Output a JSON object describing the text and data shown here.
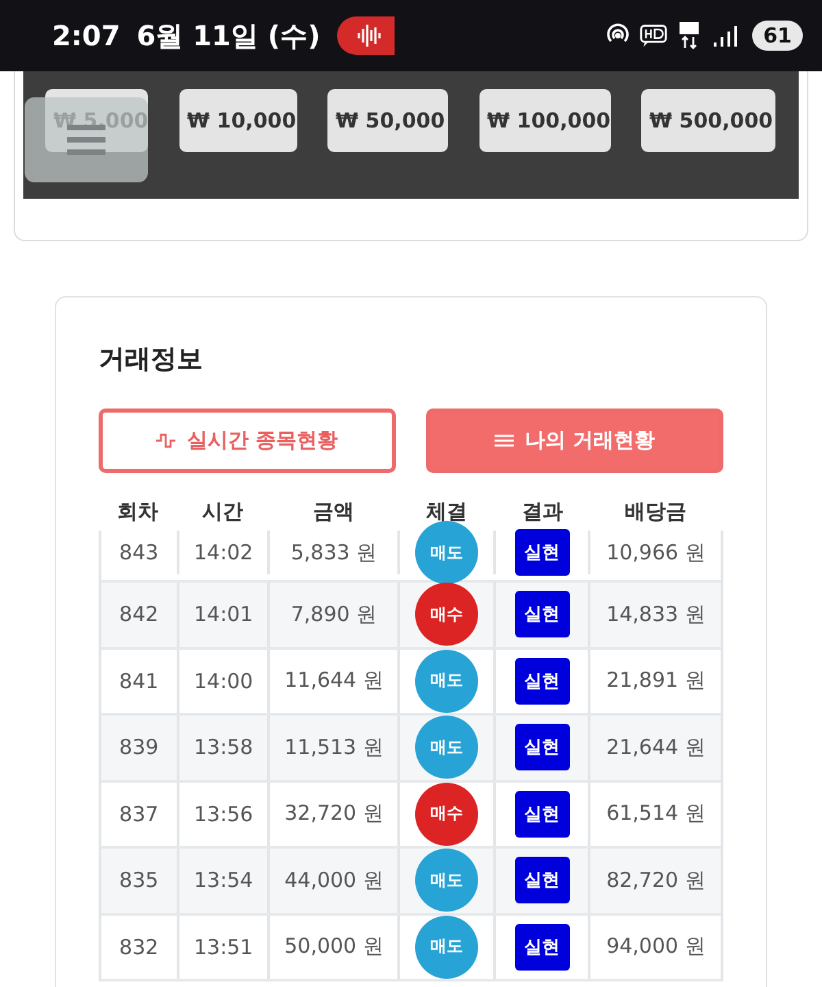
{
  "status_bar": {
    "time": "2:07",
    "date": "6월 11일 (수)",
    "battery": "61"
  },
  "amount_buttons": [
    "₩ 5,000",
    "₩ 10,000",
    "₩ 50,000",
    "₩ 100,000",
    "₩ 500,000"
  ],
  "trade_info": {
    "title": "거래정보",
    "tabs": [
      {
        "label": "실시간 종목현황",
        "selected": false,
        "kind": "live"
      },
      {
        "label": "나의 거래현황",
        "selected": true,
        "kind": "mine"
      }
    ],
    "table": {
      "columns": [
        "회차",
        "시간",
        "금액",
        "체결",
        "결과",
        "배당금"
      ],
      "rows": [
        {
          "round": "843",
          "time": "14:02",
          "amount": "5,833 원",
          "fill": {
            "label": "매도",
            "kind": "sell"
          },
          "result": "실현",
          "payout": "10,966 원"
        },
        {
          "round": "842",
          "time": "14:01",
          "amount": "7,890 원",
          "fill": {
            "label": "매수",
            "kind": "buy"
          },
          "result": "실현",
          "payout": "14,833 원"
        },
        {
          "round": "841",
          "time": "14:00",
          "amount": "11,644 원",
          "fill": {
            "label": "매도",
            "kind": "sell"
          },
          "result": "실현",
          "payout": "21,891 원"
        },
        {
          "round": "839",
          "time": "13:58",
          "amount": "11,513 원",
          "fill": {
            "label": "매도",
            "kind": "sell"
          },
          "result": "실현",
          "payout": "21,644 원"
        },
        {
          "round": "837",
          "time": "13:56",
          "amount": "32,720 원",
          "fill": {
            "label": "매수",
            "kind": "buy"
          },
          "result": "실현",
          "payout": "61,514 원"
        },
        {
          "round": "835",
          "time": "13:54",
          "amount": "44,000 원",
          "fill": {
            "label": "매도",
            "kind": "sell"
          },
          "result": "실현",
          "payout": "82,720 원"
        },
        {
          "round": "832",
          "time": "13:51",
          "amount": "50,000 원",
          "fill": {
            "label": "매도",
            "kind": "sell"
          },
          "result": "실현",
          "payout": "94,000 원"
        }
      ]
    }
  }
}
